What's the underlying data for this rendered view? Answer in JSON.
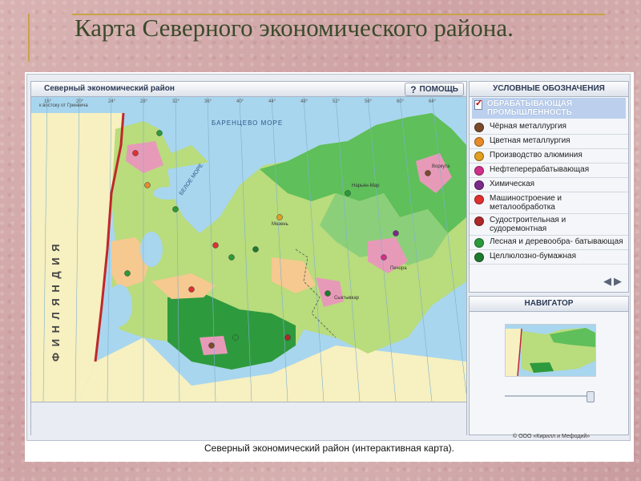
{
  "slide": {
    "title": "Карта Северного экономического района."
  },
  "app": {
    "map_panel": {
      "title": "Северный экономический район",
      "help_button": "ПОМОЩЬ",
      "map_labels": {
        "sea_barents": "БАРЕНЦЕВО МОРЕ",
        "sea_white": "БЕЛОЕ МОРЕ",
        "country": "Ф И Н Л Я Н Д И Я",
        "meridian_note": "к востоку от Гринвича",
        "longitudes": [
          "16°",
          "20°",
          "24°",
          "28°",
          "32°",
          "36°",
          "40°",
          "44°",
          "48°",
          "52°",
          "56°",
          "60°",
          "64°"
        ],
        "cities": [
          "Печора",
          "Сыктывкар",
          "Мезень",
          "Нарьян-Мар",
          "Воркута"
        ]
      }
    },
    "legend": {
      "title": "УСЛОВНЫЕ ОБОЗНАЧЕНИЯ",
      "group": "ОБРАБАТЫВАЮЩАЯ ПРОМЫШЛЕННОСТЬ",
      "items": [
        {
          "label": "Чёрная металлургия",
          "color": "#7a4a2a"
        },
        {
          "label": "Цветная металлургия",
          "color": "#e88a2a"
        },
        {
          "label": "Производство алюминия",
          "color": "#e0a020"
        },
        {
          "label": "Нефтеперерабатывающая",
          "color": "#d0308a"
        },
        {
          "label": "Химическая",
          "color": "#7a2a8a"
        },
        {
          "label": "Машиностроение и металообработка",
          "color": "#e03030"
        },
        {
          "label": "Судостроительная и судоремонтная",
          "color": "#b02828"
        },
        {
          "label": "Лесная и деревообра- батывающая",
          "color": "#2a9a3a"
        },
        {
          "label": "Целлюлозно-бумажная",
          "color": "#1e7a2e"
        }
      ]
    },
    "navigator": {
      "title": "НАВИГАТОР"
    }
  },
  "figure": {
    "copyright": "© ООО «Кирилл и Мефодий»",
    "caption": "Северный экономический район (интерактивная карта)."
  },
  "colors": {
    "sea": "#a8d6ee",
    "taiga_light": "#b9dc7c",
    "forest": "#4bb64e",
    "forest_dark": "#2e9a3e",
    "tundra": "#8ccf7a",
    "agri": "#f5c98f",
    "industrial": "#e79ab8",
    "foreign_land": "#f7f0c0",
    "border": "#c0282a"
  }
}
